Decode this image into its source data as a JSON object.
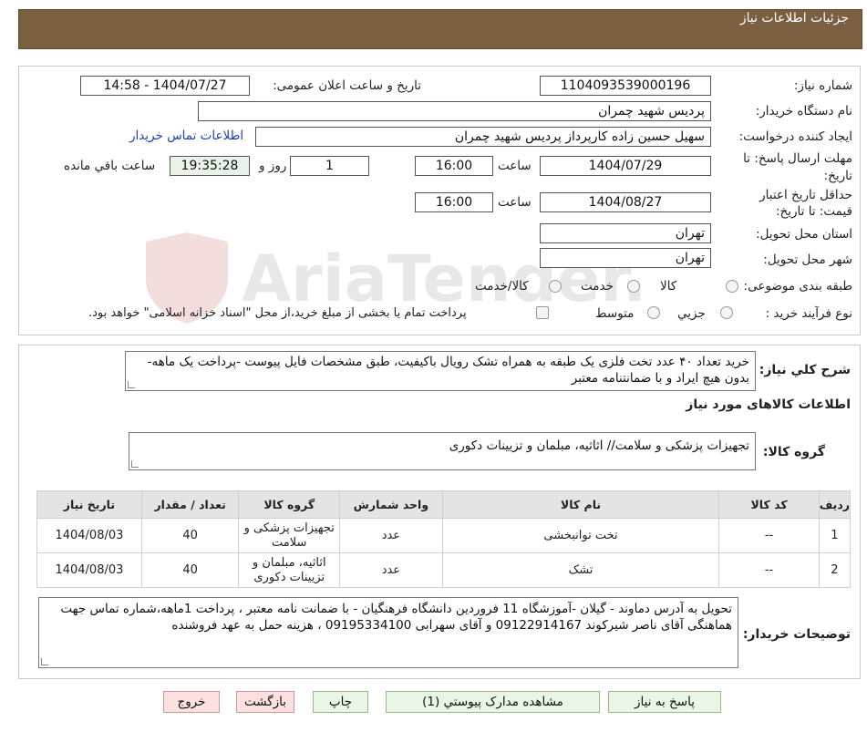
{
  "header": {
    "title": "جزئیات اطلاعات نیاز"
  },
  "form": {
    "need_number": {
      "label": "شماره نیاز:",
      "value": "1104093539000196"
    },
    "announce_datetime": {
      "label": "تاریخ و ساعت اعلان عمومی:",
      "value": "1404/07/27 - 14:58"
    },
    "buyer_org": {
      "label": "نام دستگاه خریدار:",
      "value": "پردیس شهید چمران"
    },
    "requester": {
      "label": "ایجاد کننده درخواست:",
      "value": "سهیل حسین زاده کارپرداز پردیس شهید چمران",
      "contact_link": "اطلاعات تماس خریدار"
    },
    "reply_deadline": {
      "label_line1": "مهلت ارسال پاسخ: تا",
      "label_line2": "تاریخ:",
      "date": "1404/07/29",
      "time_label": "ساعت",
      "time": "16:00",
      "days": "1",
      "days_label": "روز و",
      "remaining": "19:35:28",
      "remaining_label": "ساعت باقي مانده"
    },
    "price_validity": {
      "label_line1": "حداقل تاریخ اعتبار",
      "label_line2": "قیمت: تا تاریخ:",
      "date": "1404/08/27",
      "time_label": "ساعت",
      "time": "16:00"
    },
    "province": {
      "label": "استان محل تحویل:",
      "value": "تهران"
    },
    "city": {
      "label": "شهر محل تحویل:",
      "value": "تهران"
    },
    "category": {
      "label": "طبقه بندی موضوعی:",
      "options": [
        "کالا",
        "خدمت",
        "کالا/خدمت"
      ]
    },
    "process": {
      "label": "نوع فرآیند خرید :",
      "options": [
        "جزیي",
        "متوسط"
      ],
      "payment_note": "پرداخت تمام یا بخشی از مبلغ خرید،از محل \"اسناد خزانه اسلامی\" خواهد بود."
    }
  },
  "description": {
    "label": "شرح کلي نياز:",
    "value": "خرید تعداد ۴۰ عدد تخت فلزی یک طبقه به همراه تشک رویال باکیفیت، طبق مشخصات فایل پیوست  -پرداخت یک ماهه- بدون هیچ ایراد و با ضمانتنامه معتبر"
  },
  "goods_section": {
    "title": "اطلاعات کالاهای مورد نیاز",
    "group_label": "گروه کالا:",
    "group_value": "تجهیزات پزشکی و سلامت// اثاثیه، مبلمان و تزیینات دکوری"
  },
  "table": {
    "headers": [
      "ردیف",
      "کد کالا",
      "نام کالا",
      "واحد شمارش",
      "گروه کالا",
      "تعداد / مقدار",
      "تاریخ نیاز"
    ],
    "rows": [
      {
        "row": "1",
        "code": "--",
        "name": "تخت توانبخشی",
        "unit": "عدد",
        "group": "تجهیزات پزشکی و سلامت",
        "qty": "40",
        "date": "1404/08/03"
      },
      {
        "row": "2",
        "code": "--",
        "name": "تشک",
        "unit": "عدد",
        "group": "اثاثیه، مبلمان و تزیینات دکوری",
        "qty": "40",
        "date": "1404/08/03"
      }
    ]
  },
  "buyer_notes": {
    "label": "توضیحات خریدار:",
    "value": "تحویل به آدرس دماوند - گیلان -آموزشگاه 11 فروردین دانشگاه فرهنگیان - با ضمانت نامه معتبر ، پرداخت 1ماهه،شماره تماس جهت هماهنگی آقای ناصر شیرکوند 09122914167 و آقای سهرابی 09195334100 ، هزینه حمل به عهد فروشنده"
  },
  "buttons": {
    "reply": "پاسخ به نیاز",
    "attachments": "مشاهده مدارک پیوستي (1)",
    "print": "چاپ",
    "back": "بازگشت",
    "exit": "خروج"
  },
  "watermark": {
    "text": "AriaTender.neT"
  },
  "colors": {
    "header_bg": "#7a6040",
    "link": "#1a3fb0",
    "table_header": "#e4e4e4",
    "green_button": "#eaf6e4",
    "pink_button": "#fde0e0"
  }
}
